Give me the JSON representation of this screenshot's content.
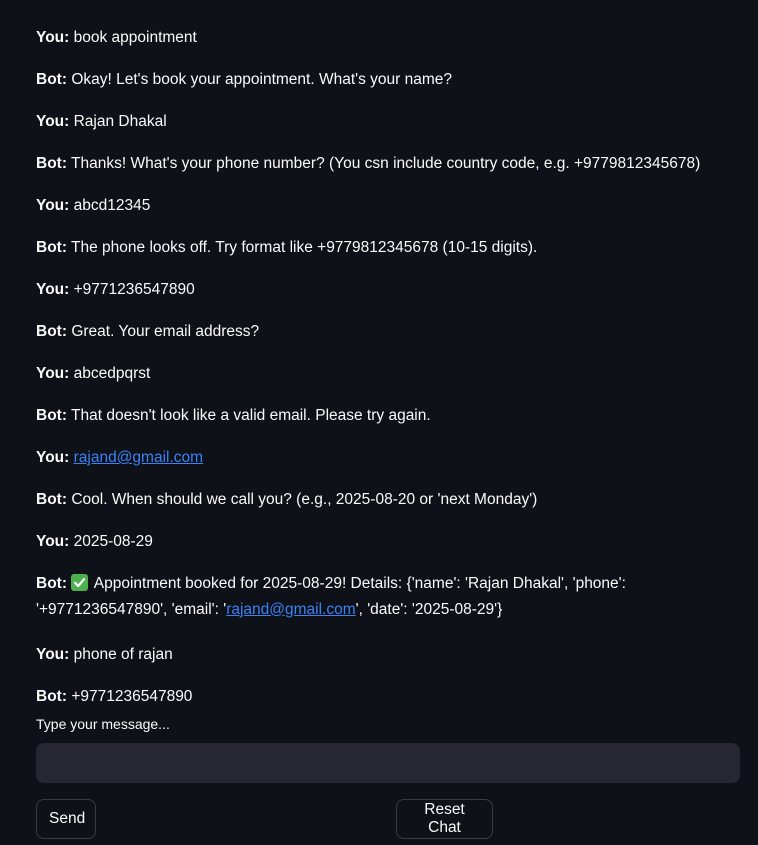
{
  "chat": {
    "messages": [
      {
        "who": "You:",
        "text": "book appointment"
      },
      {
        "who": "Bot:",
        "text": "Okay! Let's book your appointment. What's your name?"
      },
      {
        "who": "You:",
        "text": "Rajan Dhakal"
      },
      {
        "who": "Bot:",
        "text": "Thanks! What's your phone number? (You csn include country code, e.g. +9779812345678)"
      },
      {
        "who": "You:",
        "text": "abcd12345"
      },
      {
        "who": "Bot:",
        "text": "The phone looks off. Try format like +9779812345678 (10-15 digits)."
      },
      {
        "who": "You:",
        "text": "+9771236547890"
      },
      {
        "who": "Bot:",
        "text": "Great. Your email address?"
      },
      {
        "who": "You:",
        "text": "abcedpqrst"
      },
      {
        "who": "Bot:",
        "text": "That doesn't look like a valid email. Please try again."
      },
      {
        "who": "You:",
        "link": "rajand@gmail.com"
      },
      {
        "who": "Bot:",
        "text": "Cool. When should we call you? (e.g., 2025-08-20 or 'next Monday')"
      },
      {
        "who": "You:",
        "text": "2025-08-29"
      },
      {
        "who": "Bot:",
        "icon": "check-mark-icon",
        "text_before_link": "Appointment booked for 2025-08-29! Details: {'name': 'Rajan Dhakal', 'phone': '+9771236547890', 'email': '",
        "link": "rajand@gmail.com",
        "text_after_link": "', 'date': '2025-08-29'}"
      },
      {
        "who": "You:",
        "text": "phone of rajan"
      },
      {
        "who": "Bot:",
        "text": "+9771236547890"
      }
    ]
  },
  "input": {
    "label": "Type your message...",
    "value": "",
    "placeholder": ""
  },
  "buttons": {
    "send_label": "Send",
    "reset_label": "Reset Chat"
  },
  "colors": {
    "background": "#0e1117",
    "input_background": "#262730",
    "link": "#3b82f6",
    "check": "#4caf50"
  }
}
